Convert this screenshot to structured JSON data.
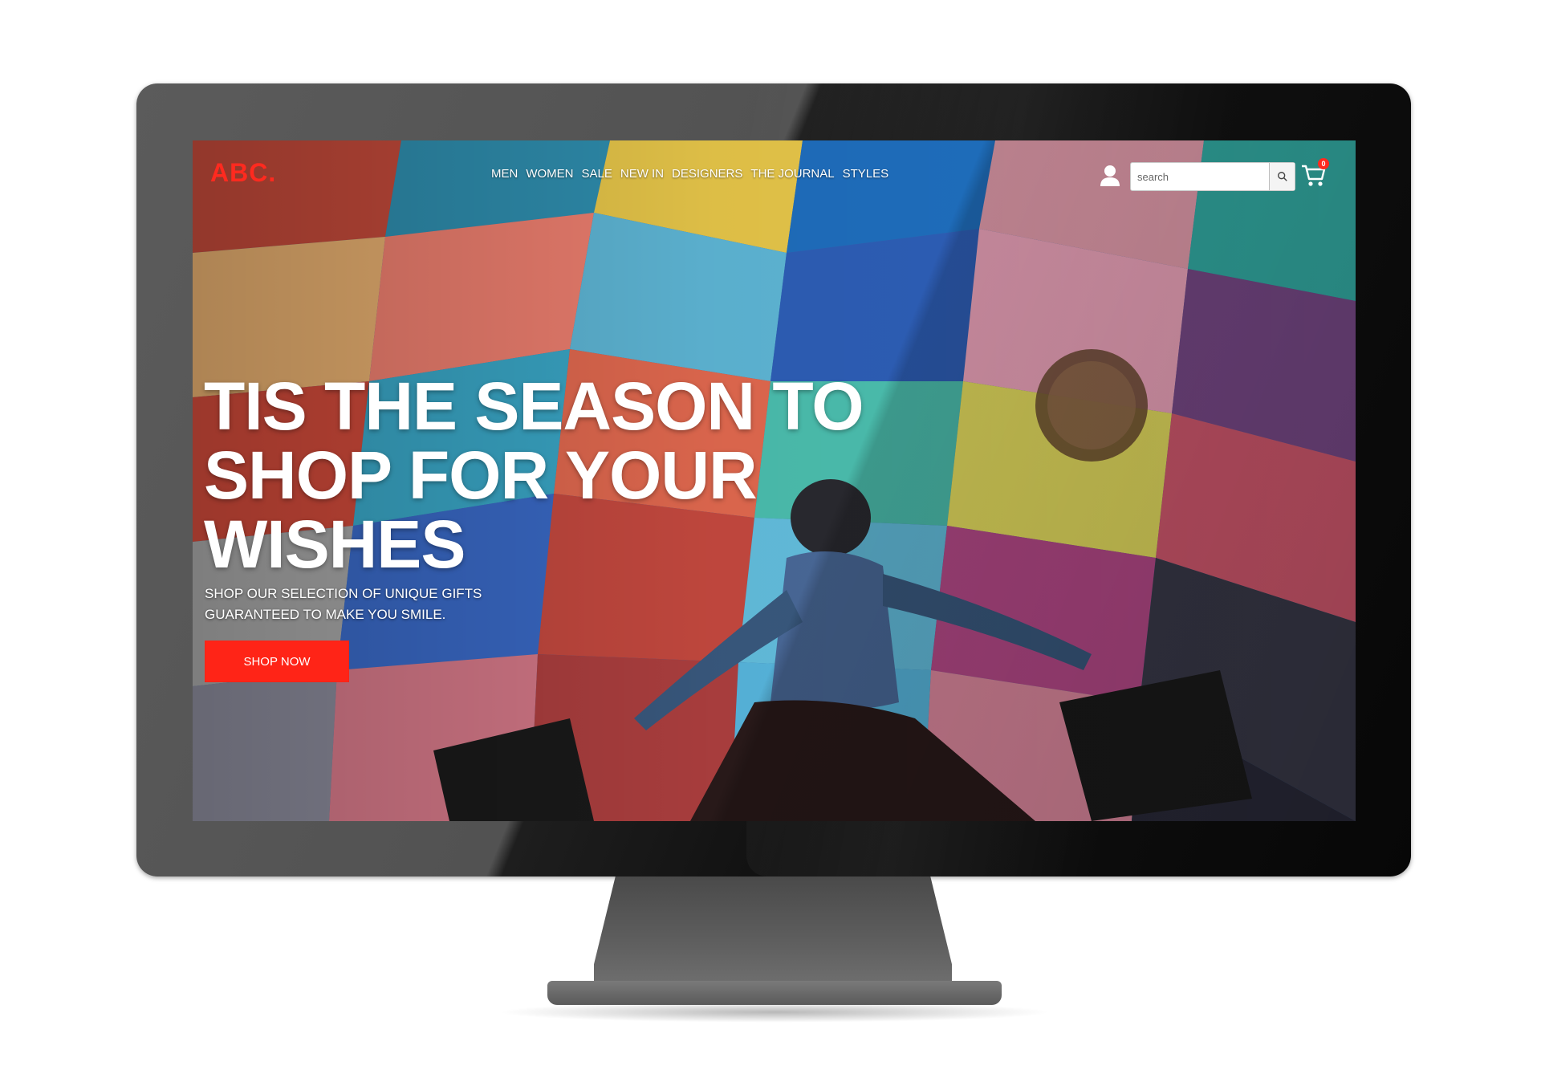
{
  "brand": {
    "logo_text": "ABC.",
    "accent_color": "#ff2a1f"
  },
  "nav": {
    "items": [
      {
        "label": "MEN"
      },
      {
        "label": "WOMEN"
      },
      {
        "label": "SALE"
      },
      {
        "label": "NEW IN"
      },
      {
        "label": "DESIGNERS"
      },
      {
        "label": "THE JOURNAL"
      },
      {
        "label": "STYLES"
      }
    ]
  },
  "header": {
    "user_icon": "user-icon",
    "search": {
      "placeholder": "search",
      "value": "",
      "button_icon": "search-icon"
    },
    "cart": {
      "icon": "cart-icon",
      "count": "0"
    }
  },
  "hero": {
    "title": "TIS THE SEASON TO SHOP FOR YOUR WISHES",
    "subtitle": "SHOP OUR SELECTION OF UNIQUE GIFTS GUARANTEED TO MAKE YOU SMILE.",
    "cta_label": "SHOP NOW",
    "cta_color": "#ff2417"
  }
}
